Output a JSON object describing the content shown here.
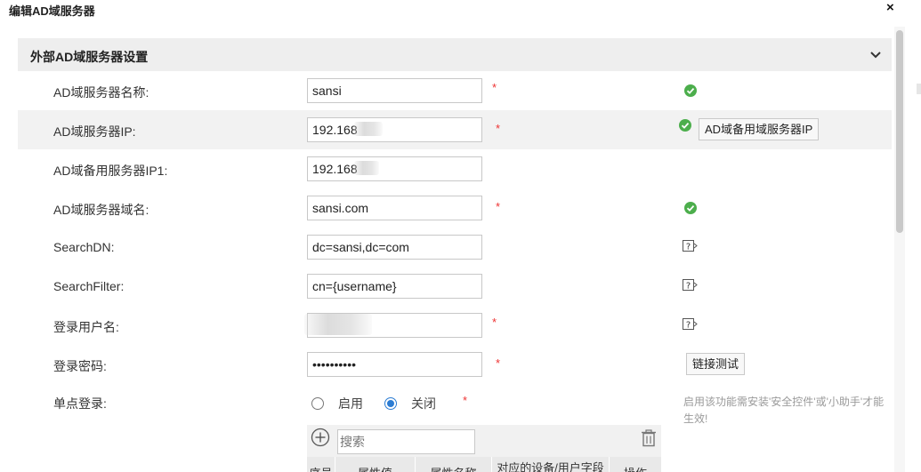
{
  "dialog": {
    "title": "编辑AD域服务器",
    "close_label": "×"
  },
  "section": {
    "title": "外部AD域服务器设置"
  },
  "fields": {
    "name": {
      "label": "AD域服务器名称:",
      "value": "sansi",
      "required": "*"
    },
    "ip": {
      "label": "AD域服务器IP:",
      "value": "192.168",
      "required": "*",
      "backup_button": "AD域备用域服务器IP"
    },
    "backup_ip1": {
      "label": "AD域备用服务器IP1:",
      "value": "192.168"
    },
    "domain": {
      "label": "AD域服务器域名:",
      "value": "sansi.com",
      "required": "*"
    },
    "search_dn": {
      "label": "SearchDN:",
      "value": "dc=sansi,dc=com"
    },
    "search_filter": {
      "label": "SearchFilter:",
      "value": "cn={username}"
    },
    "login_user": {
      "label": "登录用户名:",
      "value": "",
      "required": "*"
    },
    "login_password": {
      "label": "登录密码:",
      "value": "••••••••••",
      "required": "*",
      "test_button": "链接测试"
    },
    "sso": {
      "label": "单点登录:",
      "options": [
        "启用",
        "关闭"
      ],
      "selected": "关闭",
      "required": "*",
      "note": "启用该功能需安装'安全控件'或'小助手'才能生效!"
    }
  },
  "table": {
    "search_placeholder": "搜索",
    "headers": [
      "序号",
      "属性值",
      "属性名称",
      "对应的设备/用户字段",
      "操作"
    ]
  },
  "icons": {
    "valid": "check-circle-icon",
    "help": "help-icon",
    "add": "plus-circle-icon",
    "delete": "trash-icon",
    "collapse": "chevron-down-icon"
  },
  "colors": {
    "valid": "#4cae4c",
    "required": "#e33333",
    "radio_selected": "#2b7cd3"
  }
}
